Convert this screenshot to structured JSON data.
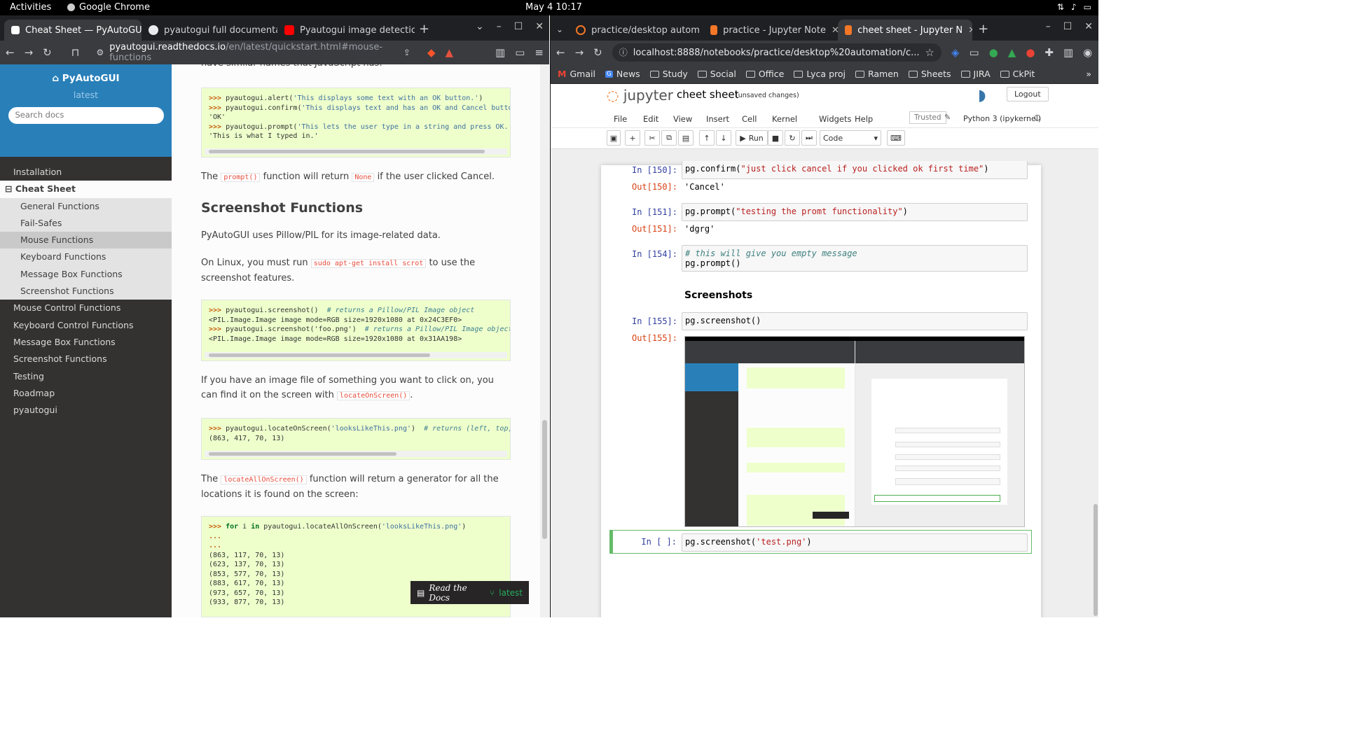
{
  "topbar": {
    "activities": "Activities",
    "app": "Google Chrome",
    "clock": "May 4  10:17"
  },
  "left": {
    "tabs": [
      {
        "title": "Cheat Sheet — PyAutoGU",
        "color": "#fff"
      },
      {
        "title": "pyautogui full documentatio",
        "color": "#e8eaed"
      },
      {
        "title": "Pyautogui image detection -",
        "color": "#ff0000"
      }
    ],
    "url_host": "pyautogui.readthedocs.io",
    "url_path": "/en/latest/quickstart.html#mouse-functions",
    "sidebar": {
      "project": "PyAutoGUI",
      "version": "latest",
      "search_placeholder": "Search docs",
      "nav": [
        "Installation",
        "Cheat Sheet",
        "General Functions",
        "Fail-Safes",
        "Mouse Functions",
        "Keyboard Functions",
        "Message Box Functions",
        "Screenshot Functions",
        "Mouse Control Functions",
        "Keyboard Control Functions",
        "Message Box Functions",
        "Screenshot Functions",
        "Testing",
        "Roadmap",
        "pyautogui"
      ]
    },
    "main": {
      "top_cut": "have similar names that JavaScript has:",
      "code1": [
        [
          ">>> ",
          "pyautogui.alert(",
          "'This displays some text with an OK button.'",
          ")"
        ],
        [
          ">>> ",
          "pyautogui.confirm(",
          "'This displays text and has an OK and Cancel button",
          ""
        ],
        [
          "",
          "'OK'",
          "",
          ""
        ],
        [
          ">>> ",
          "pyautogui.prompt(",
          "'This lets the user type in a string and press OK.'",
          ")"
        ],
        [
          "",
          "'This is what I typed in.'",
          "",
          ""
        ]
      ],
      "p1_a": "The ",
      "p1_code": "prompt()",
      "p1_b": " function will return ",
      "p1_code2": "None",
      "p1_c": " if the user clicked Cancel.",
      "h2": "Screenshot Functions",
      "p2": "PyAutoGUI uses Pillow/PIL for its image-related data.",
      "p3_a": "On Linux, you must run ",
      "p3_code": "sudo apt-get install scrot",
      "p3_b": " to use the screenshot features.",
      "code2": [
        [
          ">>> ",
          "pyautogui.screenshot()  ",
          "# returns a Pillow/PIL Image object"
        ],
        [
          "",
          "<PIL.Image.Image image mode=RGB size=1920x1080 at 0x24C3EF0>",
          ""
        ],
        [
          ">>> ",
          "pyautogui.screenshot('foo.png')  ",
          "# returns a Pillow/PIL Image object,"
        ],
        [
          "",
          "<PIL.Image.Image image mode=RGB size=1920x1080 at 0x31AA198>",
          ""
        ]
      ],
      "p4_a": "If you have an image file of something you want to click on, you can find it on the screen with ",
      "p4_code": "locateOnScreen()",
      "p4_b": ".",
      "code3": [
        [
          ">>> ",
          "pyautogui.locateOnScreen(",
          "'looksLikeThis.png'",
          ")  ",
          "# returns (left, top, w"
        ],
        [
          "",
          "(863, 417, 70, 13)",
          "",
          "",
          ""
        ]
      ],
      "p5_a": "The ",
      "p5_code": "locateAllOnScreen()",
      "p5_b": " function will return a generator for all the locations it is found on the screen:",
      "code4_first": [
        ">>> ",
        "for",
        " i ",
        "in",
        " pyautogui.locateAllOnScreen(",
        "'looksLikeThis.png'",
        ")"
      ],
      "code4_rest": [
        "...",
        "...",
        "(863, 117, 70, 13)",
        "(623, 137, 70, 13)",
        "(853, 577, 70, 13)",
        "(883, 617, 70, 13)",
        "(973, 657, 70, 13)",
        "(933, 877, 70, 13)"
      ],
      "badge_label": "Read the Docs",
      "badge_version": "latest"
    }
  },
  "right": {
    "tabs": [
      {
        "title": "practice/desktop autom",
        "color": "#f37726"
      },
      {
        "title": "practice - Jupyter Note",
        "color": "#f37726"
      },
      {
        "title": "cheet sheet - Jupyter N",
        "color": "#f37726"
      }
    ],
    "url": "localhost:8888/notebooks/practice/desktop%20automation/c...",
    "bookmarks": [
      "Gmail",
      "News",
      "Study",
      "Social",
      "Office",
      "Lyca proj",
      "Ramen",
      "Sheets",
      "JIRA",
      "CkPit"
    ],
    "jupyter": {
      "logo": "jupyter",
      "nb_name": "cheet sheet",
      "status": "(unsaved changes)",
      "logout": "Logout",
      "menu": [
        "File",
        "Edit",
        "View",
        "Insert",
        "Cell",
        "Kernel",
        "Widgets",
        "Help"
      ],
      "trusted": "Trusted",
      "kernel": "Python 3 (ipykernel)",
      "run": "Run",
      "celltype": "Code",
      "cells": [
        {
          "in": "In [150]:",
          "code_pre": "pg.confirm(",
          "code_str": "\"just click cancel if you clicked ok first time\"",
          "code_post": ")",
          "out": "Out[150]:",
          "result": "'Cancel'"
        },
        {
          "in": "In [151]:",
          "code_pre": "pg.prompt(",
          "code_str": "\"testing the promt functionality\"",
          "code_post": ")",
          "out": "Out[151]:",
          "result": "'dgrg'"
        }
      ],
      "cell154": {
        "in": "In [154]:",
        "comment": "# this will give you empty message",
        "code": "pg.prompt()"
      },
      "markdown": "Screenshots",
      "cell155": {
        "in": "In [155]:",
        "code": "pg.screenshot()",
        "out": "Out[155]:"
      },
      "cell_new": {
        "in": "In [ ]:",
        "code_pre": "pg.screenshot(",
        "code_str": "'test.png'",
        "code_post": ")"
      }
    }
  }
}
